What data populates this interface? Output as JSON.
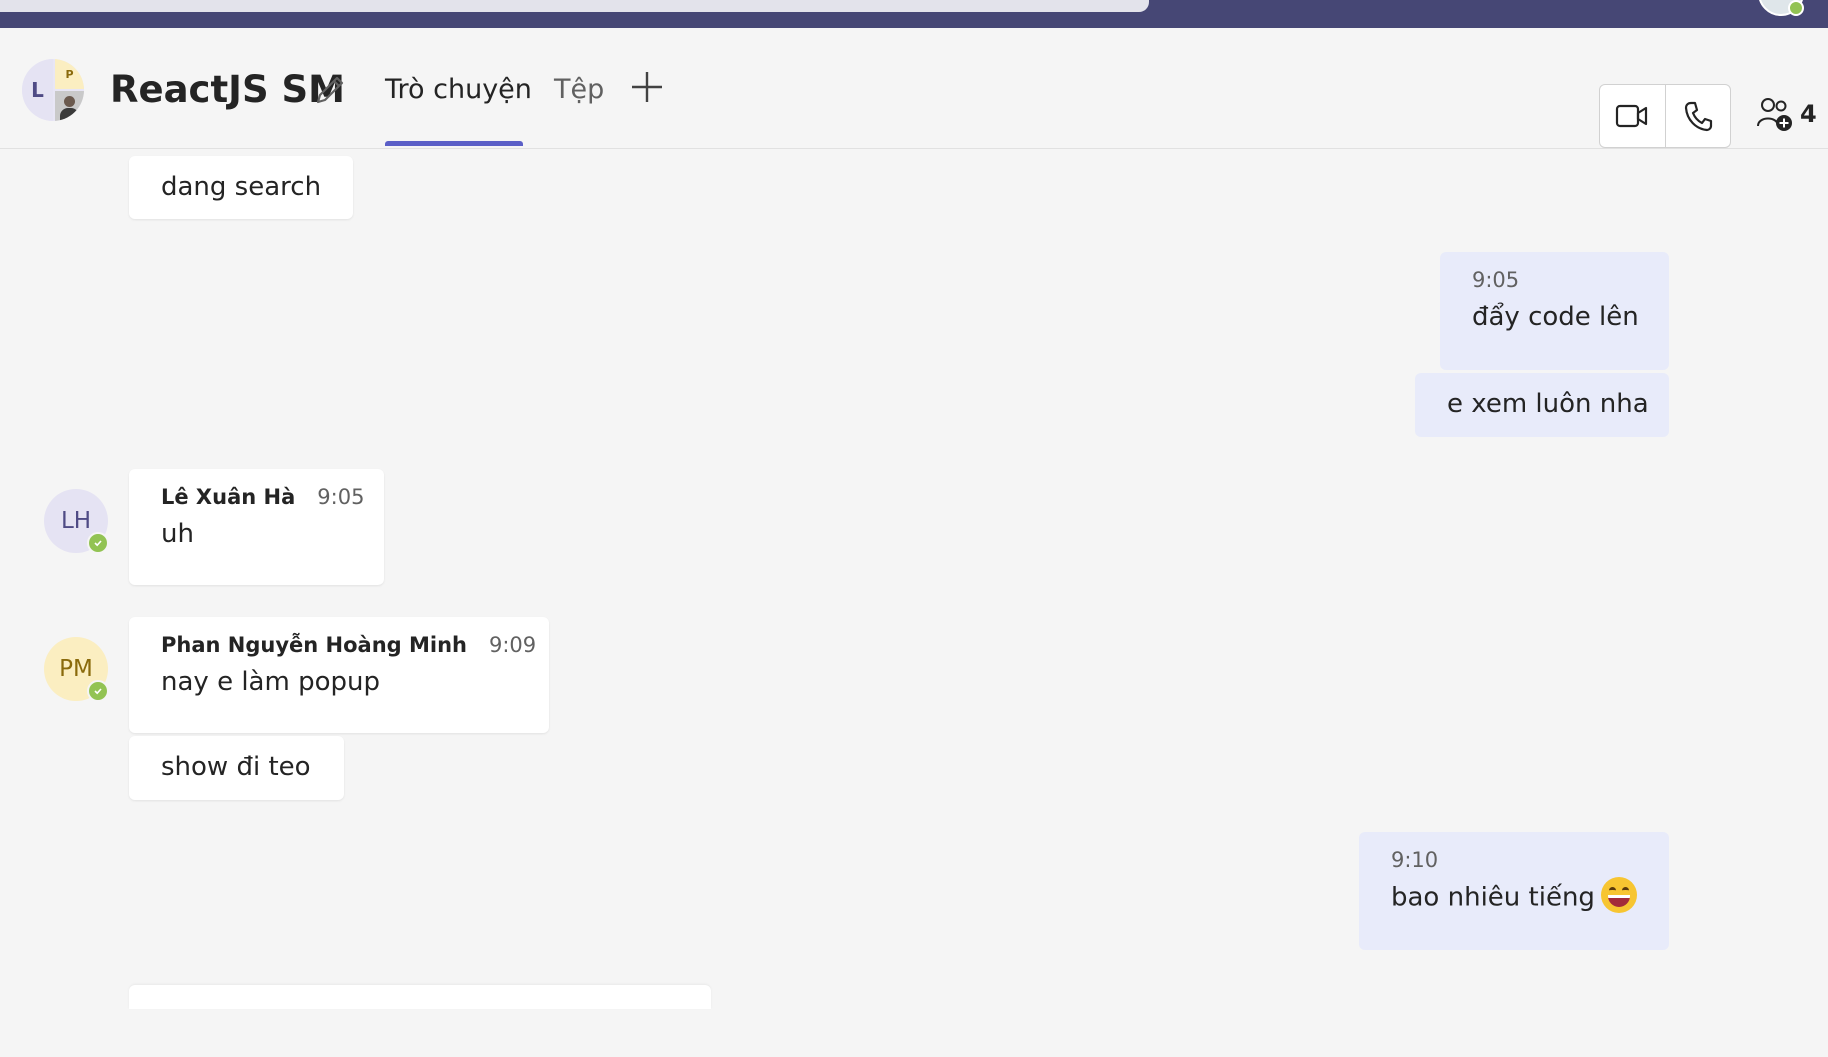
{
  "header": {
    "title": "ReactJS SM",
    "group_avatar": {
      "initial": "L",
      "secondary_initial": "P"
    },
    "tabs": [
      {
        "label": "Trò chuyện",
        "active": true
      },
      {
        "label": "Tệp",
        "active": false
      }
    ],
    "participants_count": "4",
    "icons": [
      "edit-icon",
      "add-tab-icon",
      "video-call-icon",
      "audio-call-icon",
      "people-add-icon"
    ]
  },
  "messages": [
    {
      "direction": "in",
      "text": "dang search"
    },
    {
      "direction": "out",
      "time": "9:05",
      "text": "đẩy code lên"
    },
    {
      "direction": "out",
      "text": "e xem luôn nha"
    },
    {
      "direction": "in",
      "author": "Lê Xuân Hà",
      "initials": "LH",
      "time": "9:05",
      "text": "uh"
    },
    {
      "direction": "in",
      "author": "Phan Nguyễn Hoàng Minh",
      "initials": "PM",
      "time": "9:09",
      "text": "nay e làm popup"
    },
    {
      "direction": "in",
      "text": "show đi teo"
    },
    {
      "direction": "out",
      "time": "9:10",
      "text": "bao nhiêu tiếng",
      "emoji": "grinning-face-emoji"
    }
  ],
  "colors": {
    "app_bar": "#464775",
    "accent": "#5b5fc7",
    "background": "#f5f5f5",
    "outgoing_bubble": "#e8ebfa",
    "incoming_bubble": "#ffffff",
    "presence_available": "#92c353"
  }
}
